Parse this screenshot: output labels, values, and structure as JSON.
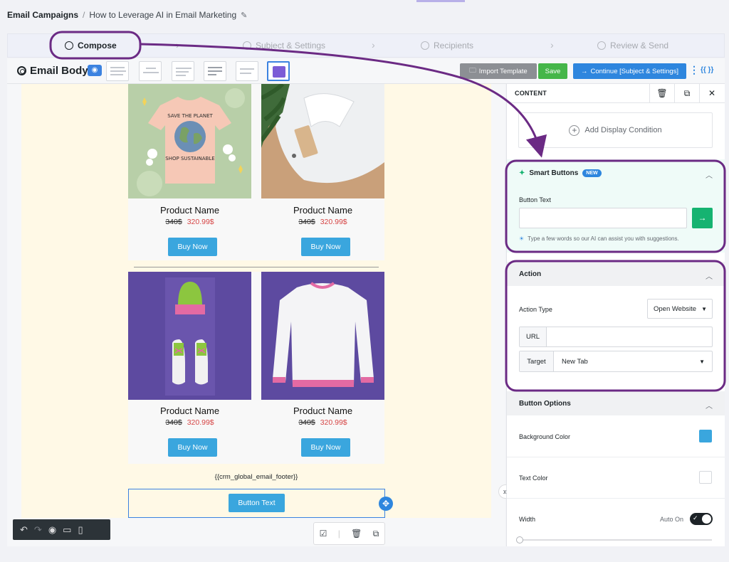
{
  "breadcrumb": {
    "root": "Email Campaigns",
    "separator": "/",
    "current": "How to Leverage AI in Email Marketing"
  },
  "stepper": {
    "steps": [
      "Compose",
      "Subject & Settings",
      "Recipients",
      "Review & Send"
    ]
  },
  "toolbar": {
    "title": "Email Body",
    "import_label": "Import Template",
    "save_label": "Save",
    "continue_label": "Continue [Subject & Settings]",
    "merge_tags": "{{ }}"
  },
  "products": [
    {
      "name": "Product Name",
      "old_price": "340$",
      "new_price": "320.99$",
      "button": "Buy Now",
      "image": "tshirt-illustration"
    },
    {
      "name": "Product Name",
      "old_price": "340$",
      "new_price": "320.99$",
      "button": "Buy Now",
      "image": "white-polo-shirt"
    },
    {
      "name": "Product Name",
      "old_price": "340$",
      "new_price": "320.99$",
      "button": "Buy Now",
      "image": "beanie-and-sneakers"
    },
    {
      "name": "Product Name",
      "old_price": "340$",
      "new_price": "320.99$",
      "button": "Buy Now",
      "image": "white-sweatshirt"
    }
  ],
  "tshirt_text": {
    "line1": "SAVE THE PLANET",
    "line2": "SHOP SUSTAINABLE"
  },
  "footer_token": "{{crm_global_email_footer}}",
  "selected_button_text": "Button Text",
  "panel": {
    "header": "CONTENT",
    "add_condition": "Add Display Condition",
    "smart_buttons": {
      "title": "Smart Buttons",
      "badge": "NEW",
      "field_label": "Button Text",
      "input_value": "",
      "hint": "Type a few words so our AI can assist you with suggestions."
    },
    "action": {
      "title": "Action",
      "type_label": "Action Type",
      "type_value": "Open Website",
      "url_label": "URL",
      "url_value": "",
      "target_label": "Target",
      "target_value": "New Tab"
    },
    "button_options": {
      "title": "Button Options",
      "background_label": "Background Color",
      "background_color": "#3aa6de",
      "text_color_label": "Text Color",
      "text_color": "#ffffff",
      "width_label": "Width",
      "width_toggle_label": "Auto On",
      "width_auto": true
    }
  },
  "colors": {
    "primary": "#2e86de",
    "save": "#45b649",
    "annotation": "#6b2a84",
    "smart_bg": "#effbf8",
    "price_red": "#d64545"
  }
}
